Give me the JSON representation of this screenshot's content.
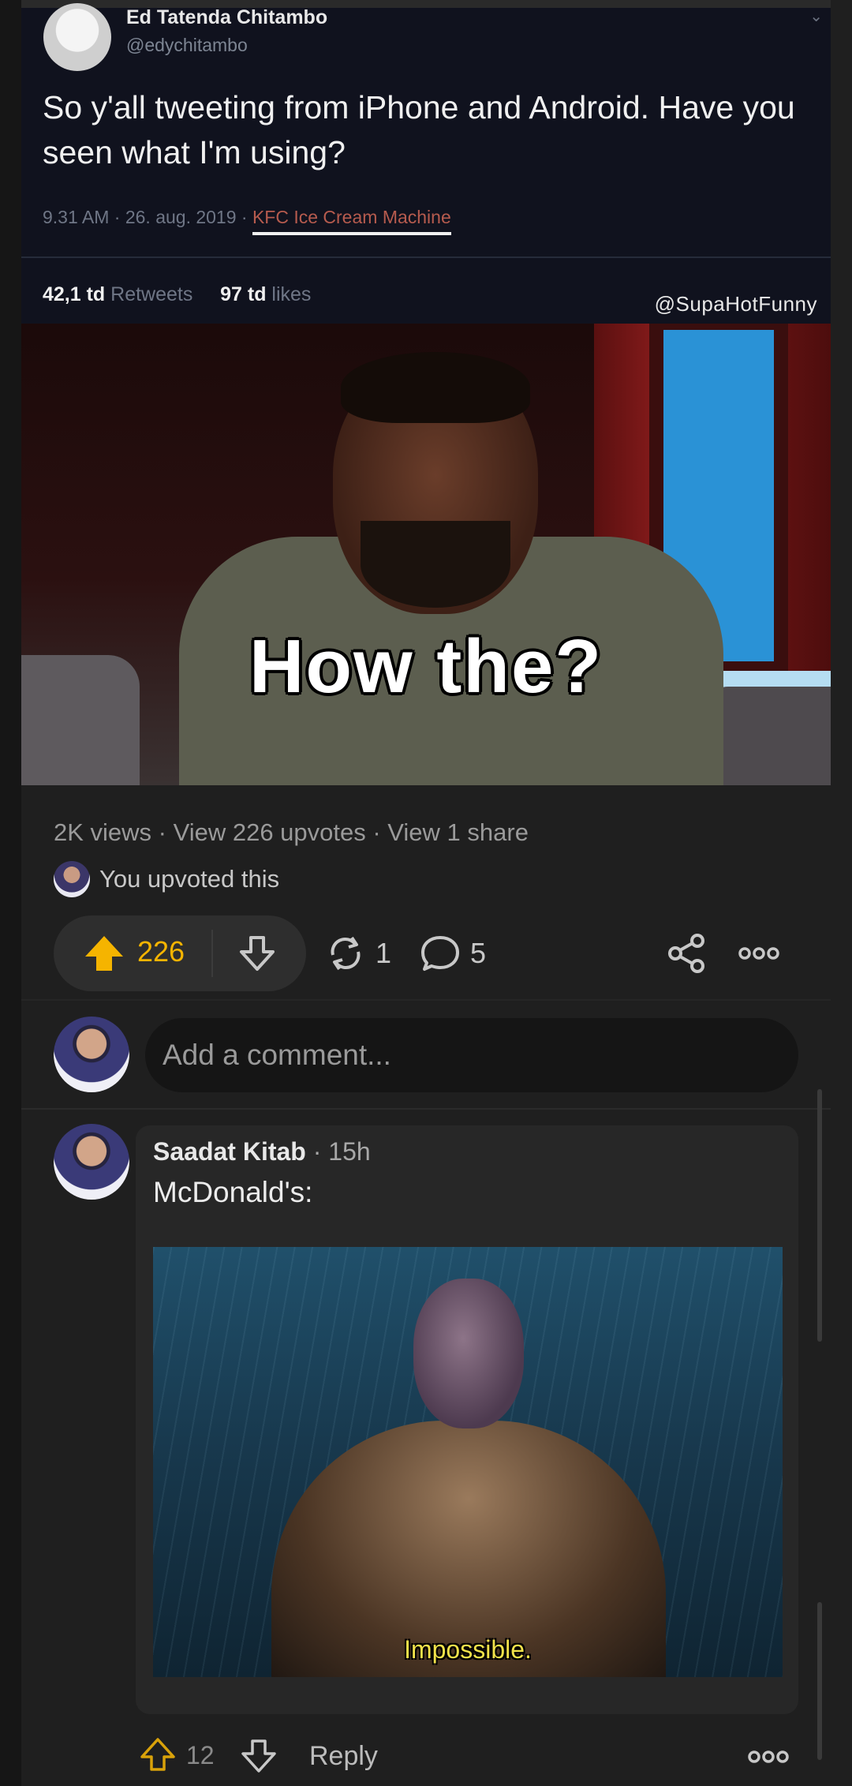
{
  "tweet": {
    "name": "Ed Tatenda Chitambo",
    "handle": "@edychitambo",
    "text": "So y'all tweeting from iPhone and Android. Have you seen what I'm using?",
    "meta_prefix": "9.31 AM · 26. aug. 2019 · ",
    "source": "KFC Ice Cream Machine",
    "retweets_count": "42,1 td",
    "retweets_label": "Retweets",
    "likes_count": "97 td",
    "likes_label": "likes",
    "watermark": "@SupaHotFunny"
  },
  "meme": {
    "caption": "How the?"
  },
  "post": {
    "stats": "2K views · View 226 upvotes · View 1 share",
    "upvoted_text": "You upvoted this",
    "upvotes": "226",
    "shares": "1",
    "comments": "5"
  },
  "add_comment": {
    "placeholder": "Add a comment..."
  },
  "comment": {
    "author": "Saadat Kitab",
    "time": " · 15h",
    "text": "McDonald's:",
    "image_caption": "Impossible.",
    "upvotes": "12",
    "reply_label": "Reply"
  },
  "colors": {
    "upvote_accent": "#f5b400",
    "background": "#1f1f1f"
  }
}
